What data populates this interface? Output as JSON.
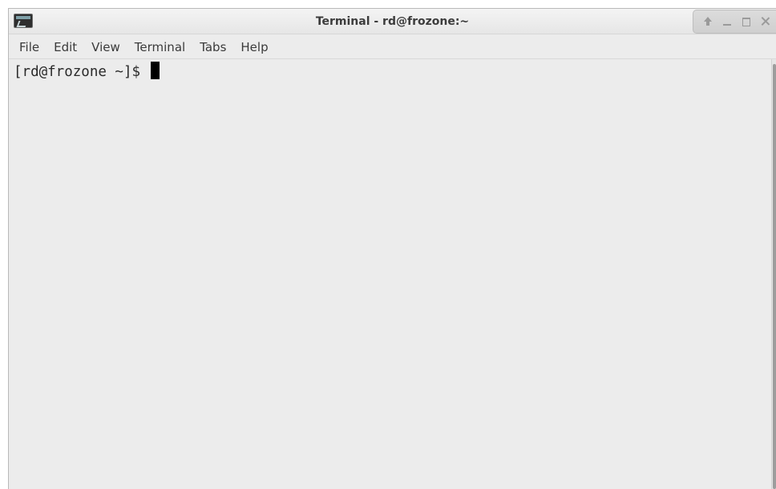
{
  "window": {
    "title": "Terminal - rd@frozone:~"
  },
  "title_controls": {
    "up_icon": "arrow-up-icon",
    "minimize_icon": "minimize-icon",
    "maximize_icon": "maximize-icon",
    "close_icon": "close-icon"
  },
  "menu": {
    "items": [
      {
        "label": "File"
      },
      {
        "label": "Edit"
      },
      {
        "label": "View"
      },
      {
        "label": "Terminal"
      },
      {
        "label": "Tabs"
      },
      {
        "label": "Help"
      }
    ]
  },
  "terminal": {
    "prompt": "[rd@frozone ~]$ "
  }
}
